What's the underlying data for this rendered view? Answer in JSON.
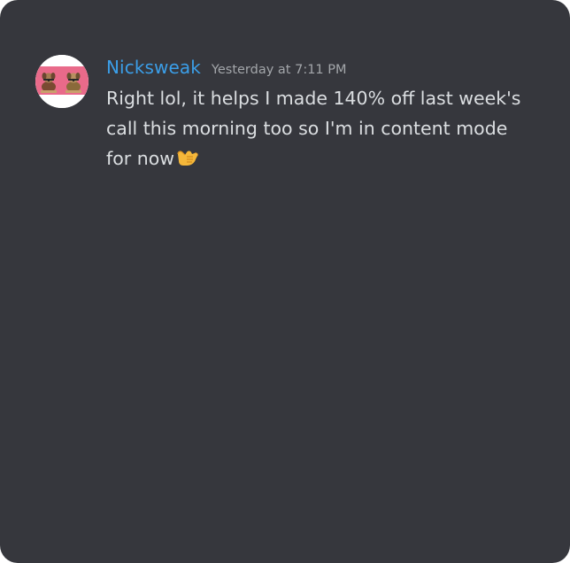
{
  "message": {
    "username": "Nicksweak",
    "timestamp": "Yesterday at 7:11 PM",
    "text": "Right lol, it helps I made 140% off last week's call this morning too so I'm in content mode for now",
    "emoji": "call-me-hand",
    "avatar": "pink banner with two dog figures"
  },
  "colors": {
    "background": "#36373d",
    "username": "#3b9ee8",
    "timestamp": "#a3a6aa",
    "text": "#dbdee1",
    "avatar_pink": "#e96a8a"
  }
}
